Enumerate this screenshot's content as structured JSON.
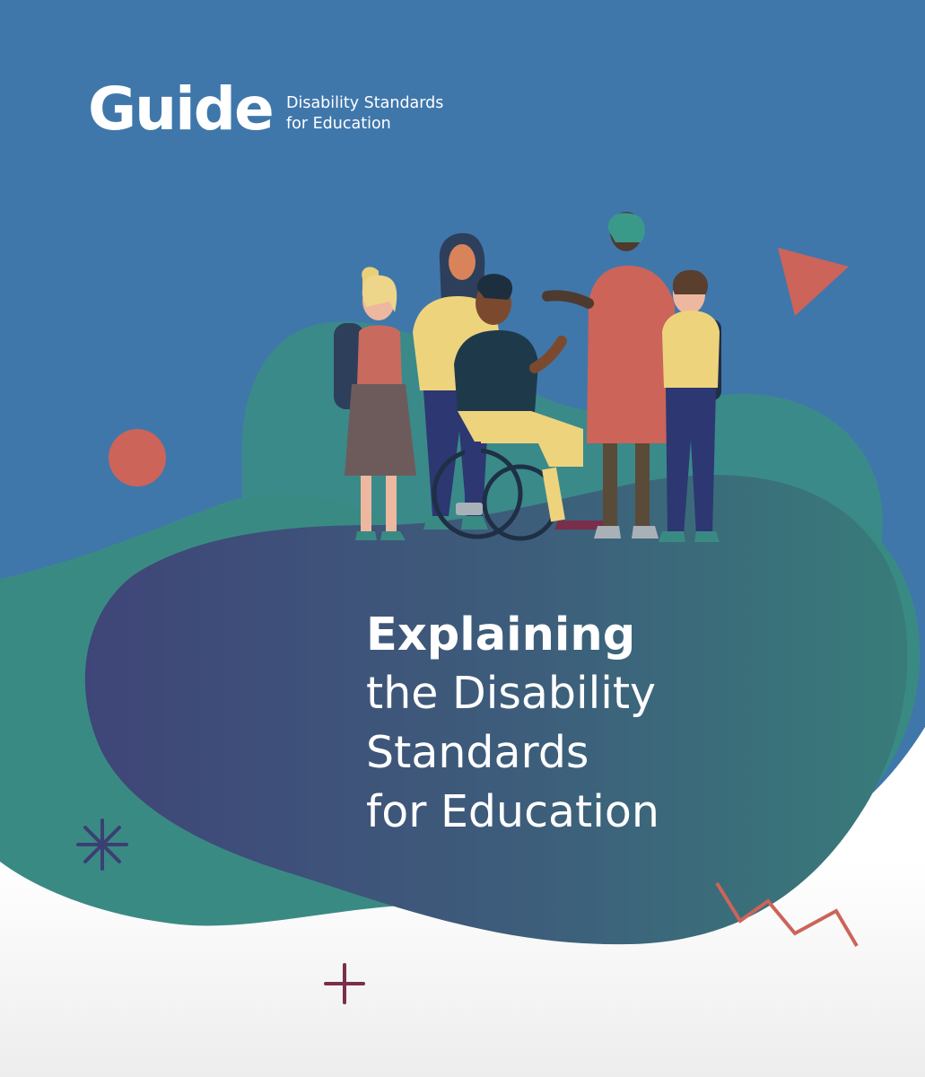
{
  "header": {
    "guide_label": "Guide",
    "subtitle_line1": "Disability Standards",
    "subtitle_line2": "for Education"
  },
  "title": {
    "line1": "Explaining",
    "line2": "the Disability",
    "line3": "Standards",
    "line4": "for Education"
  },
  "colors": {
    "blue_background": "#3f77ab",
    "teal_blob": "#3a8a86",
    "navy_blob": "#3f4b78",
    "coral_accent": "#cc6459",
    "plum_accent": "#7a2e4c",
    "indigo_accent": "#3b3f72",
    "text": "#ffffff"
  },
  "decorations": {
    "icons": [
      "triangle-icon",
      "circle-icon",
      "asterisk-icon",
      "plus-icon",
      "zigzag-icon"
    ],
    "illustration": "group-of-diverse-students-including-wheelchair-user"
  }
}
